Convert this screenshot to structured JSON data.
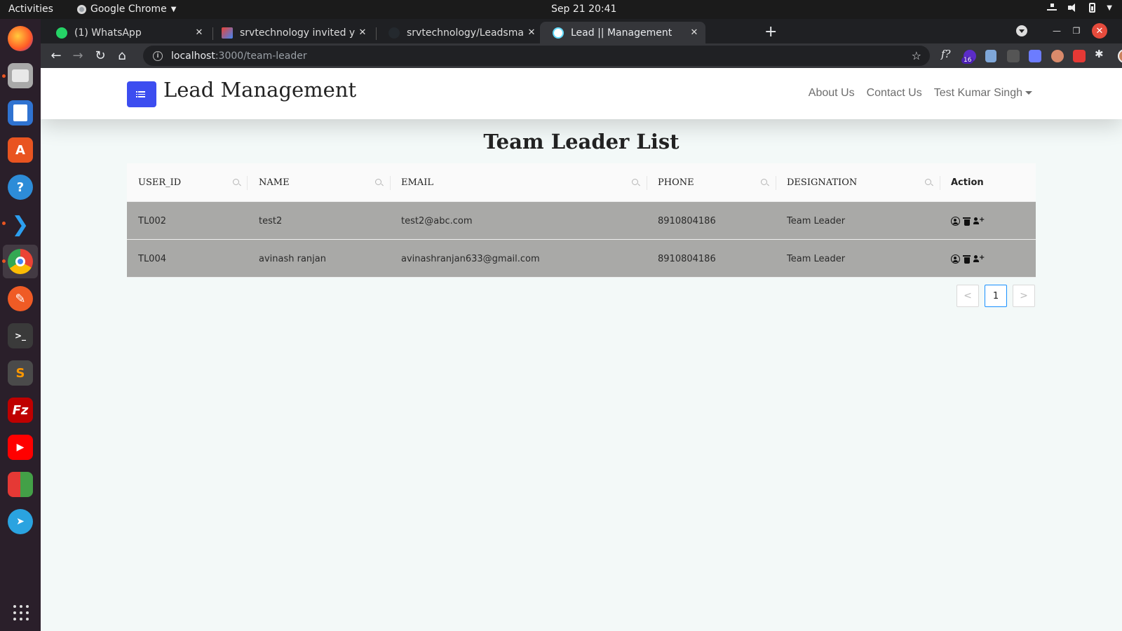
{
  "system": {
    "activities": "Activities",
    "app_name": "Google Chrome",
    "clock": "Sep 21  20:41"
  },
  "browser": {
    "tabs": [
      {
        "label": "(1) WhatsApp",
        "active": false
      },
      {
        "label": "srvtechnology invited you",
        "active": false
      },
      {
        "label": "srvtechnology/Leadsman",
        "active": false
      },
      {
        "label": "Lead || Management",
        "active": true
      }
    ],
    "new_tab": "+",
    "url_host": "localhost",
    "url_path": ":3000/team-leader",
    "extension_badge": "16"
  },
  "dock": {
    "apps": [
      "firefox",
      "files",
      "writer",
      "software",
      "help",
      "vscode",
      "chrome",
      "postman",
      "terminal",
      "sublime",
      "filezilla",
      "youtube",
      "stack",
      "telegram"
    ]
  },
  "page": {
    "brand": "Lead Management",
    "nav": {
      "about": "About Us",
      "contact": "Contact Us",
      "user": "Test Kumar Singh"
    },
    "title": "Team Leader List",
    "table": {
      "headers": [
        "USER_ID",
        "NAME",
        "EMAIL",
        "PHONE",
        "DESIGNATION",
        "Action"
      ],
      "rows": [
        {
          "user_id": "TL002",
          "name": "test2",
          "email": "test2@abc.com",
          "phone": "8910804186",
          "designation": "Team Leader"
        },
        {
          "user_id": "TL004",
          "name": "avinash ranjan",
          "email": "avinashranjan633@gmail.com",
          "phone": "8910804186",
          "designation": "Team Leader"
        }
      ]
    },
    "pagination": {
      "prev": "<",
      "current": "1",
      "next": ">"
    }
  },
  "colors": {
    "accent": "#3c4df0",
    "row_bg": "#a9a9a7",
    "page_bg": "#f3f9f8",
    "pagination_active": "#1890ff"
  }
}
